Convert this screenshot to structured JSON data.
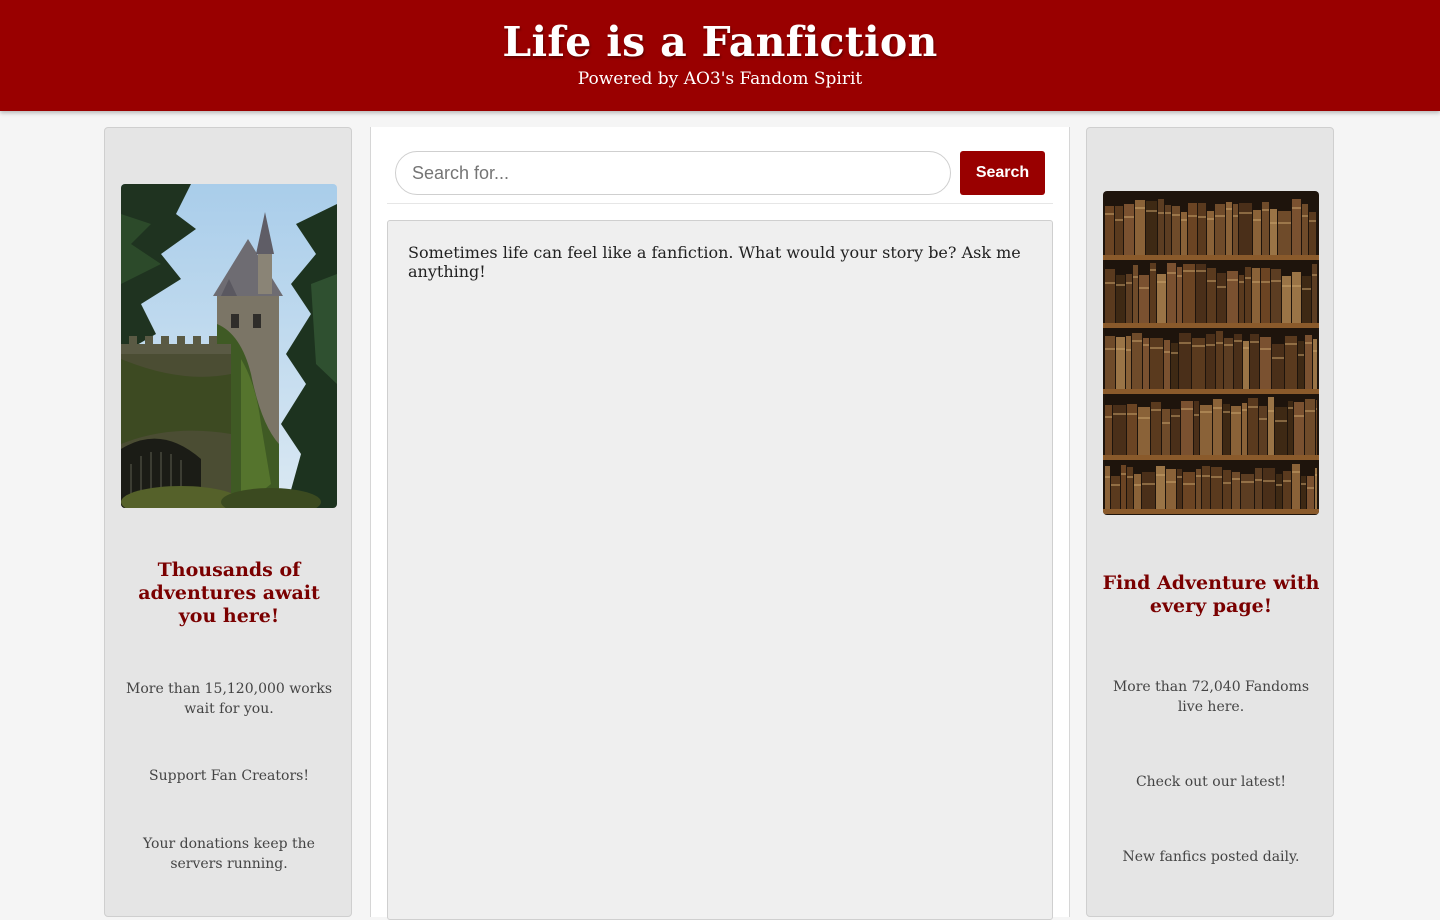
{
  "header": {
    "title": "Life is a Fanfiction",
    "subtitle": "Powered by AO3's Fandom Spirit"
  },
  "colors": {
    "brand": "#990000",
    "heading": "#7a0000",
    "sidebar_bg": "#e5e5e5",
    "panel_bg": "#efefef"
  },
  "left_sidebar": {
    "image": "castle-tower-image",
    "heading": "Thousands of adventures await you here!",
    "texts": [
      "More than 15,120,000 works wait for you.",
      "Support Fan Creators!",
      "Your donations keep the servers running."
    ]
  },
  "right_sidebar": {
    "image": "bookshelf-image",
    "heading": "Find Adventure with every page!",
    "texts": [
      "More than 72,040 Fandoms live here.",
      "Check out our latest!",
      "New fanfics posted daily."
    ]
  },
  "search": {
    "placeholder": "Search for...",
    "value": "",
    "button_label": "Search"
  },
  "chat": {
    "messages": [
      "Sometimes life can feel like a fanfiction. What would your story be? Ask me anything!"
    ]
  }
}
